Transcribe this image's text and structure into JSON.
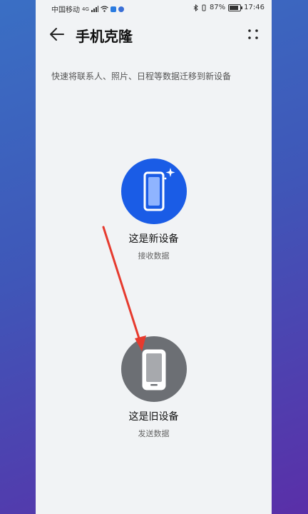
{
  "status_bar": {
    "carrier": "中国移动",
    "network": "4G",
    "battery": "87%",
    "battery_level": 0.87,
    "time": "17:46"
  },
  "header": {
    "title": "手机克隆"
  },
  "subtitle": "快速将联系人、照片、日程等数据迁移到新设备",
  "options": [
    {
      "title": "这是新设备",
      "desc": "接收数据",
      "color": "#1a5ce6"
    },
    {
      "title": "这是旧设备",
      "desc": "发送数据",
      "color": "#6c6f74"
    }
  ],
  "annotation": {
    "arrow_color": "#e63a2e"
  }
}
